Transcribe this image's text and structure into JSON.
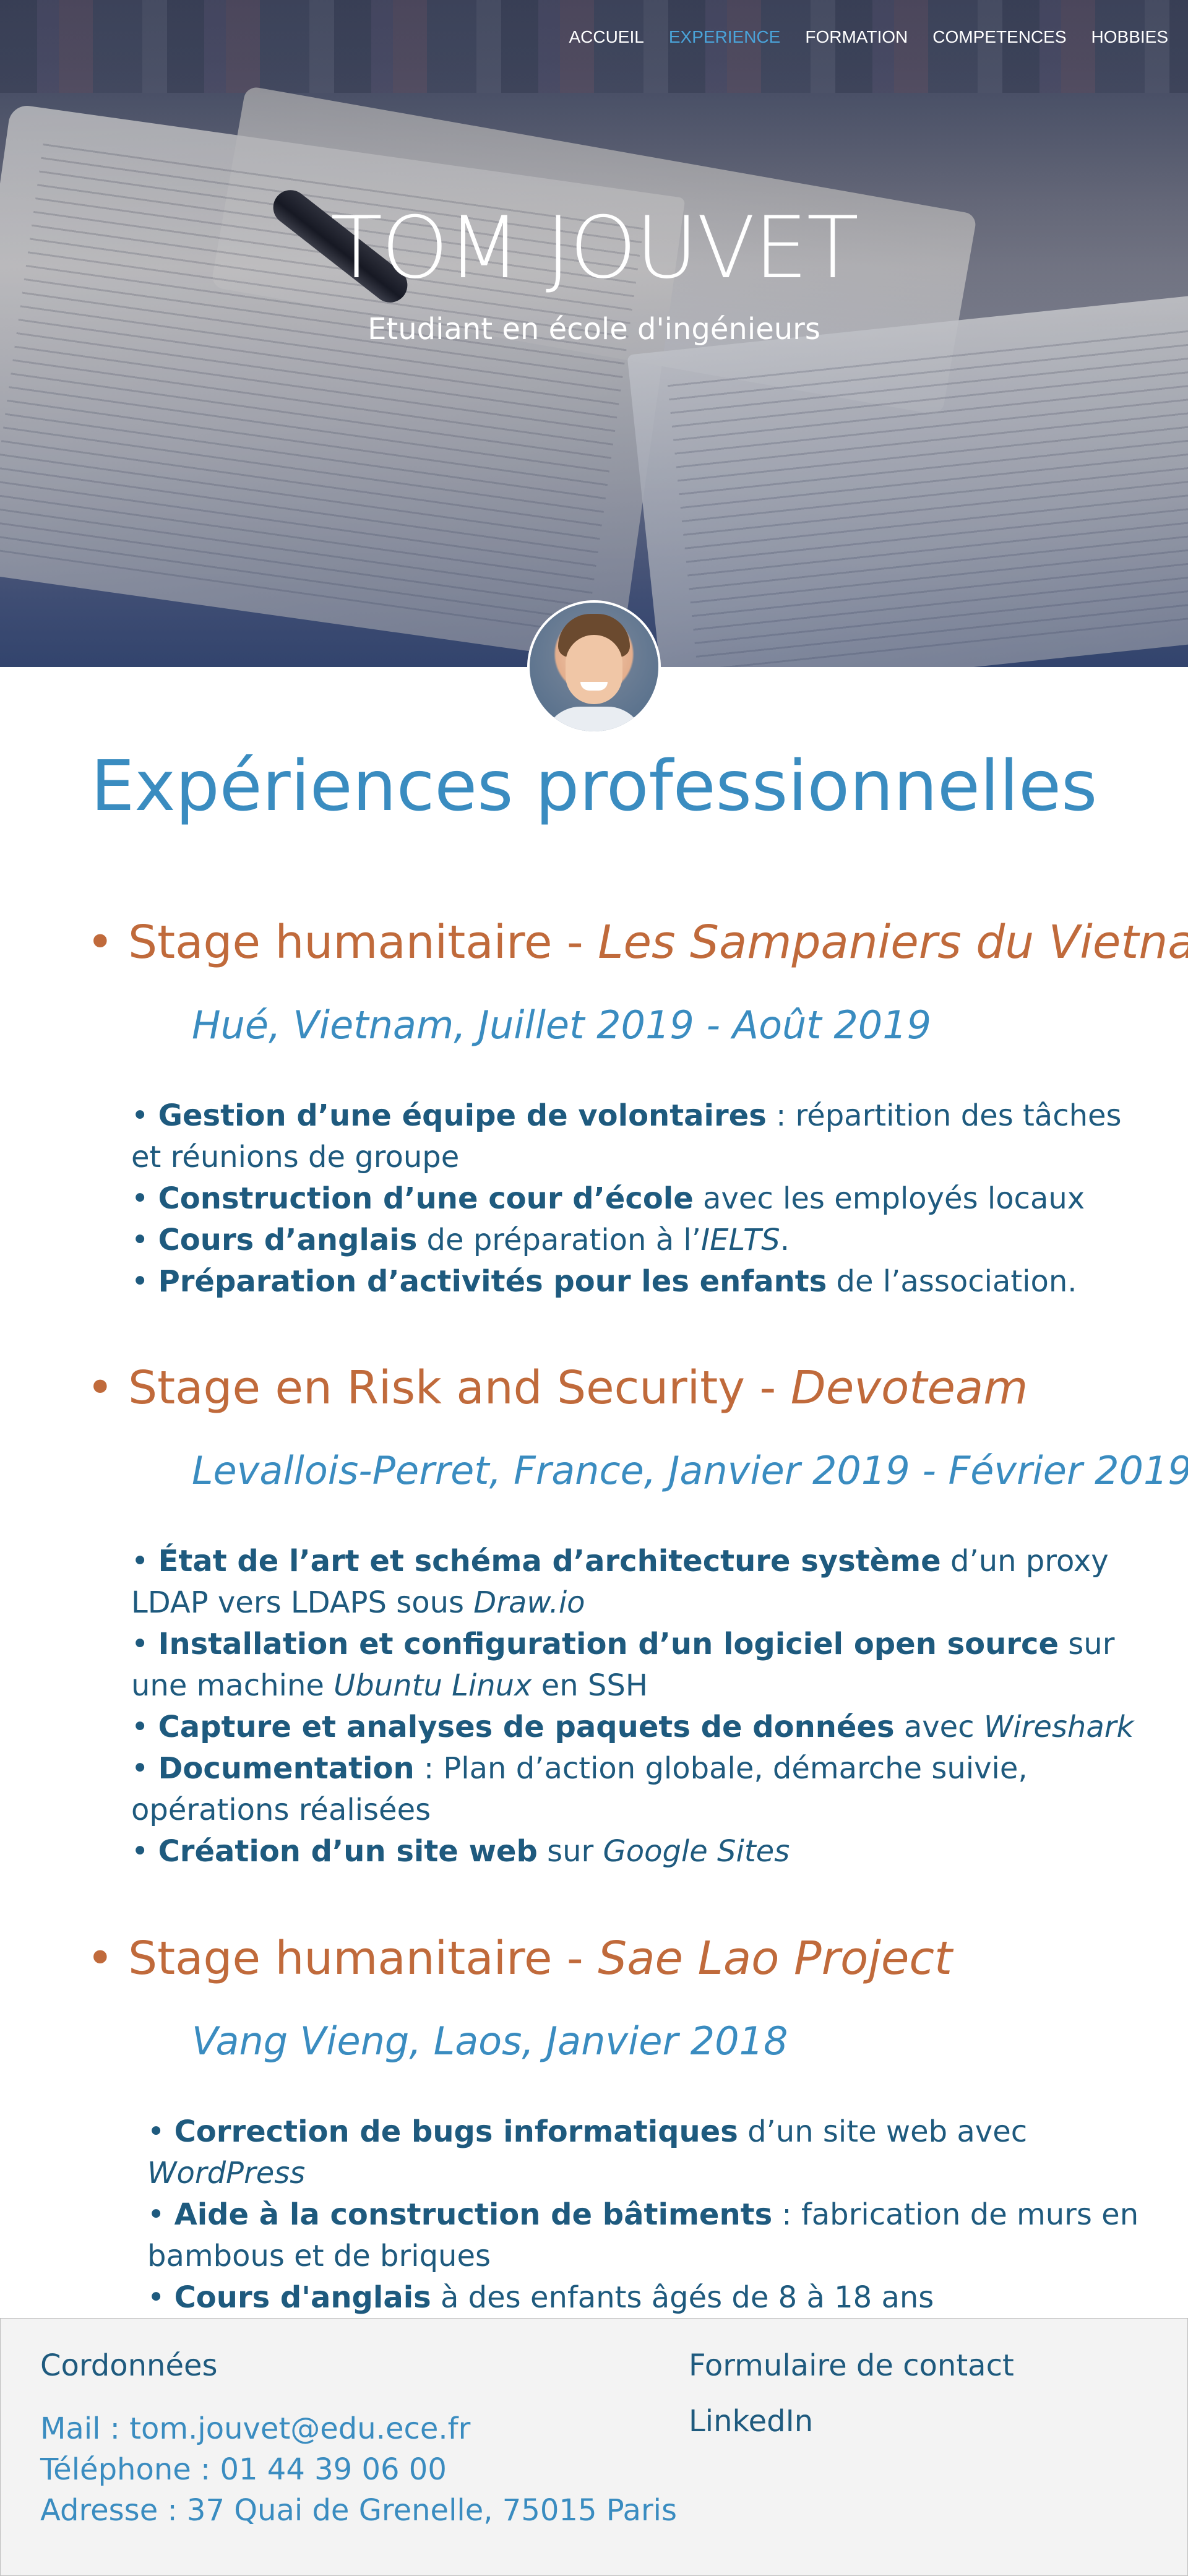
{
  "nav": {
    "items": [
      "ACCUEIL",
      "EXPERIENCE",
      "FORMATION",
      "COMPETENCES",
      "HOBBIES"
    ],
    "active": "EXPERIENCE"
  },
  "hero": {
    "name": "TOM JOUVET",
    "subtitle": "Etudiant en école d'ingénieurs"
  },
  "section": {
    "title": "Expériences professionnelles"
  },
  "experiences": [
    {
      "title_prefix": "• Stage humanitaire - ",
      "title_org": "Les Sampaniers du Vietnam",
      "meta": "Hué, Vietnam, Juillet 2019 - Août 2019",
      "bullets": [
        {
          "bold": "Gestion d’une équipe de volontaires",
          "rest": " : répartition des tâches et réunions de groupe"
        },
        {
          "bold": "Construction d’une cour d’école",
          "rest": " avec les employés locaux"
        },
        {
          "bold": "Cours d’anglais",
          "rest": " de préparation à l’",
          "italic": "IELTS",
          "rest2": "."
        },
        {
          "bold": "Préparation d’activités pour les enfants",
          "rest": " de l’association."
        }
      ]
    },
    {
      "title_prefix": "• Stage en Risk and Security - ",
      "title_org": "Devoteam",
      "meta": "Levallois-Perret, France, Janvier 2019 - Février 2019",
      "bullets": [
        {
          "bold": "État de l’art et schéma d’architecture système",
          "rest": " d’un proxy LDAP vers LDAPS sous ",
          "italic": "Draw.io",
          "rest2": ""
        },
        {
          "bold": "Installation et configuration d’un logiciel open source",
          "rest": " sur une machine ",
          "italic": "Ubuntu Linux",
          "rest2": " en SSH"
        },
        {
          "bold": "Capture et analyses de paquets de données",
          "rest": " avec ",
          "italic": "Wireshark",
          "rest2": ""
        },
        {
          "bold": "Documentation",
          "rest": " : Plan d’action globale, démarche suivie, opérations réalisées"
        },
        {
          "bold": "Création d’un site web",
          "rest": " sur ",
          "italic": "Google Sites",
          "rest2": ""
        }
      ]
    },
    {
      "title_prefix": "• Stage humanitaire - ",
      "title_org": "Sae Lao Project",
      "meta": "Vang Vieng, Laos, Janvier 2018",
      "bullets": [
        {
          "bold": "Correction de bugs informatiques",
          "rest": " d’un site web avec ",
          "italic": "WordPress",
          "rest2": ""
        },
        {
          "bold": "Aide à la construction de bâtiments",
          "rest": " : fabrication de murs en bambous et de briques"
        },
        {
          "bold": "Cours d'anglais",
          "rest": " à des enfants âgés de 8 à 18 ans",
          "prefix": "•  "
        }
      ]
    }
  ],
  "footer": {
    "heading": "Cordonnées",
    "mail": "Mail : tom.jouvet@edu.ece.fr",
    "phone": "Téléphone : 01 44 39 06 00",
    "address": "Adresse : 37 Quai de Grenelle, 75015 Paris",
    "contact_form": "Formulaire de contact",
    "linkedin": "LinkedIn"
  }
}
